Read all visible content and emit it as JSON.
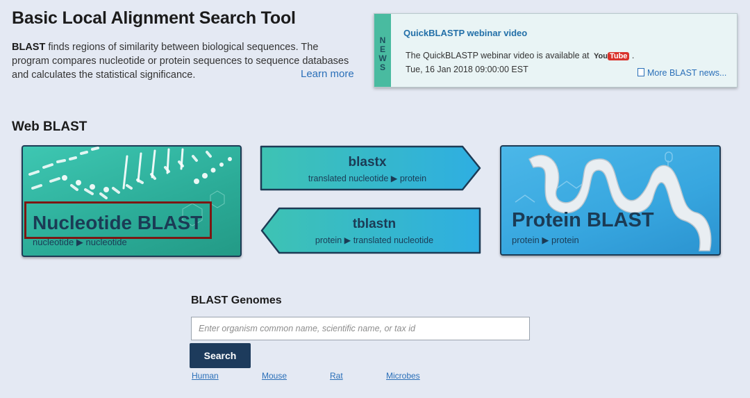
{
  "header": {
    "title": "Basic Local Alignment Search Tool",
    "intro_bold": "BLAST",
    "intro_text": " finds regions of similarity between biological sequences. The program compares nucleotide or protein sequences to sequence databases and calculates the statistical significance.",
    "learn_more": "Learn more"
  },
  "news": {
    "letters": [
      "N",
      "E",
      "W",
      "S"
    ],
    "headline": "QuickBLASTP webinar video",
    "body": "The QuickBLASTP webinar video is available at",
    "youtube_you": "You",
    "youtube_tube": "Tube",
    "body_end": ".",
    "date": "Tue, 16 Jan 2018 09:00:00 EST",
    "more": "More BLAST news..."
  },
  "web_blast": {
    "heading": "Web BLAST",
    "nucleotide": {
      "title": "Nucleotide BLAST",
      "subtitle": "nucleotide ▶ nucleotide"
    },
    "blastx": {
      "title": "blastx",
      "subtitle": "translated nucleotide ▶ protein"
    },
    "tblastn": {
      "title": "tblastn",
      "subtitle": "protein ▶ translated nucleotide"
    },
    "protein": {
      "title": "Protein BLAST",
      "subtitle": "protein ▶ protein"
    }
  },
  "genomes": {
    "heading": "BLAST Genomes",
    "placeholder": "Enter organism common name, scientific name, or tax id",
    "search_label": "Search",
    "organisms": [
      "Human",
      "Mouse",
      "Rat",
      "Microbes"
    ]
  },
  "colors": {
    "nucleotide_tile": "#2bab97",
    "protein_tile": "#37a6df",
    "highlight": "#7c1713",
    "search_button": "#1d3b5c",
    "link": "#2a6fb8"
  }
}
